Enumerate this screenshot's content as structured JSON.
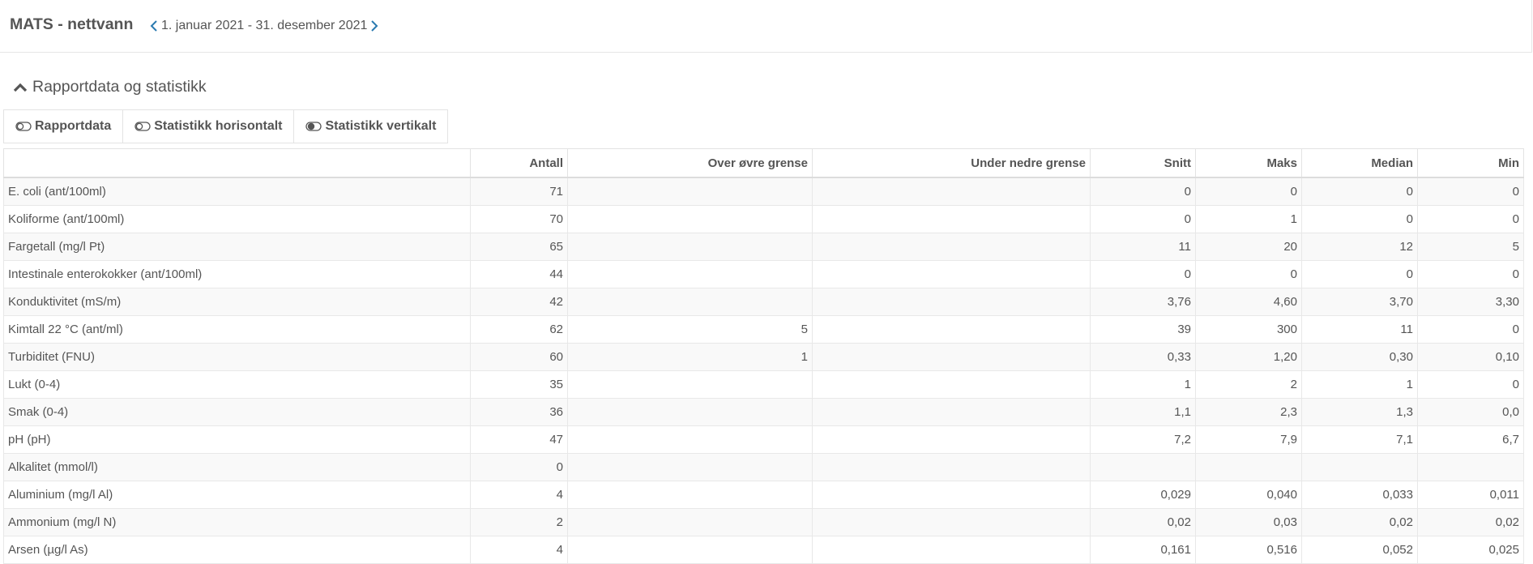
{
  "header": {
    "title": "MATS - nettvann",
    "period": "1. januar 2021 - 31. desember 2021"
  },
  "section": {
    "title": "Rapportdata og statistikk"
  },
  "toggles": [
    {
      "label": "Rapportdata",
      "on": false
    },
    {
      "label": "Statistikk horisontalt",
      "on": false
    },
    {
      "label": "Statistikk vertikalt",
      "on": true
    }
  ],
  "colors": {
    "accent": "#2a7ab0",
    "text": "#555555",
    "border": "#e3e3e3",
    "row_alt": "#f9f9f9"
  },
  "table": {
    "columns": [
      "",
      "Antall",
      "Over øvre grense",
      "Under nedre grense",
      "Snitt",
      "Maks",
      "Median",
      "Min"
    ],
    "rows": [
      [
        "E. coli (ant/100ml)",
        "71",
        "",
        "",
        "0",
        "0",
        "0",
        "0"
      ],
      [
        "Koliforme (ant/100ml)",
        "70",
        "",
        "",
        "0",
        "1",
        "0",
        "0"
      ],
      [
        "Fargetall (mg/l Pt)",
        "65",
        "",
        "",
        "11",
        "20",
        "12",
        "5"
      ],
      [
        "Intestinale enterokokker (ant/100ml)",
        "44",
        "",
        "",
        "0",
        "0",
        "0",
        "0"
      ],
      [
        "Konduktivitet (mS/m)",
        "42",
        "",
        "",
        "3,76",
        "4,60",
        "3,70",
        "3,30"
      ],
      [
        "Kimtall 22 °C (ant/ml)",
        "62",
        "5",
        "",
        "39",
        "300",
        "11",
        "0"
      ],
      [
        "Turbiditet (FNU)",
        "60",
        "1",
        "",
        "0,33",
        "1,20",
        "0,30",
        "0,10"
      ],
      [
        "Lukt (0-4)",
        "35",
        "",
        "",
        "1",
        "2",
        "1",
        "0"
      ],
      [
        "Smak (0-4)",
        "36",
        "",
        "",
        "1,1",
        "2,3",
        "1,3",
        "0,0"
      ],
      [
        "pH (pH)",
        "47",
        "",
        "",
        "7,2",
        "7,9",
        "7,1",
        "6,7"
      ],
      [
        "Alkalitet (mmol/l)",
        "0",
        "",
        "",
        "",
        "",
        "",
        ""
      ],
      [
        "Aluminium (mg/l Al)",
        "4",
        "",
        "",
        "0,029",
        "0,040",
        "0,033",
        "0,011"
      ],
      [
        "Ammonium (mg/l N)",
        "2",
        "",
        "",
        "0,02",
        "0,03",
        "0,02",
        "0,02"
      ],
      [
        "Arsen (µg/l As)",
        "4",
        "",
        "",
        "0,161",
        "0,516",
        "0,052",
        "0,025"
      ]
    ]
  }
}
